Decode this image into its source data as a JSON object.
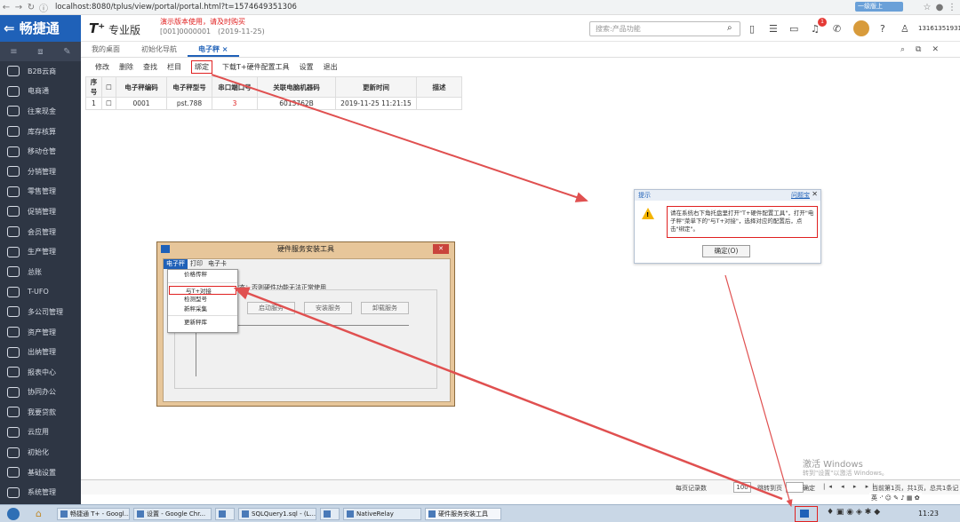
{
  "browser": {
    "url": "localhost:8080/tplus/view/portal/portal.html?t=1574649351306",
    "ext_label": "一级版上"
  },
  "header": {
    "logo": "⇐ 畅捷通",
    "brand": "T⁺",
    "brand_sub": "专业版",
    "demo_note": "演示版本使用，请及时购买",
    "account": "[001]0000001",
    "date": "(2019-11-25)",
    "search_placeholder": "搜索:产品功能",
    "notif_count": "1",
    "phone": "13161351931"
  },
  "sidebar": {
    "items": [
      {
        "label": "B2B云商"
      },
      {
        "label": "电商通"
      },
      {
        "label": "往来现金"
      },
      {
        "label": "库存核算"
      },
      {
        "label": "移动仓管"
      },
      {
        "label": "分销管理"
      },
      {
        "label": "零售管理"
      },
      {
        "label": "促销管理"
      },
      {
        "label": "会员管理"
      },
      {
        "label": "生产管理"
      },
      {
        "label": "总账"
      },
      {
        "label": "T-UFO"
      },
      {
        "label": "多公司管理"
      },
      {
        "label": "资产管理"
      },
      {
        "label": "出纳管理"
      },
      {
        "label": "报表中心"
      },
      {
        "label": "协同办公"
      },
      {
        "label": "我要贷款"
      },
      {
        "label": "云应用"
      },
      {
        "label": "初始化"
      },
      {
        "label": "基础设置"
      },
      {
        "label": "系统管理"
      }
    ]
  },
  "tabs": [
    {
      "label": "我的桌面"
    },
    {
      "label": "初始化导航"
    },
    {
      "label": "电子秤 ×"
    }
  ],
  "toolbar": {
    "items": [
      "修改",
      "删除",
      "查找",
      "栏目",
      "绑定",
      "下载T+硬件配置工具",
      "设置",
      "退出"
    ]
  },
  "grid": {
    "headers": [
      "序号",
      "☐",
      "电子秤编码",
      "电子秤型号",
      "串口端口号",
      "关联电脑机器码",
      "更新时间",
      "描述"
    ],
    "rows": [
      [
        "1",
        "☐",
        "0001",
        "pst.788",
        "3",
        "6013762B",
        "2019-11-25 11:21:15",
        ""
      ]
    ]
  },
  "pager": {
    "per_page_label": "每页记录数",
    "per_page": "100",
    "goto_label": "跳转到页",
    "confirm": "确定",
    "summary": "当前第1页，共1页，总共1条记录"
  },
  "watermark": {
    "title": "激活 Windows",
    "sub": "转到\"设置\"以激活 Windows。"
  },
  "dialog": {
    "title": "提示",
    "help": "问题宝",
    "message": "请在系统右下角托盘里打开\"T+硬件配置工具\"，打开\"电子秤\"菜单下的\"与T+对接\"，选择对应的配置后，点击\"绑定\"。",
    "ok": "确定(O)"
  },
  "hw_window": {
    "title": "硬件服务安装工具",
    "menus": [
      "电子秤",
      "打印",
      "电子卡"
    ],
    "status": "状态：否则硬件功能无法正常使用",
    "buttons": [
      "启动服务",
      "安装服务",
      "卸载服务"
    ],
    "dropdown": [
      "价格传秤",
      "与T+对接",
      "检测型号",
      "新秤采集",
      "更新秤库"
    ]
  },
  "taskbar": {
    "tasks": [
      "畅捷通 T+ - Googl...",
      "设置 - Google Chr...",
      "",
      "SQLQuery1.sql - (L...",
      "",
      "NativeRelay",
      "硬件服务安装工具"
    ],
    "clock": "11:23"
  },
  "colors": {
    "brand_blue": "#1f61b8",
    "sidebar_bg": "#2e3644",
    "alert_red": "#e02020",
    "arrow_red": "#e05050"
  }
}
